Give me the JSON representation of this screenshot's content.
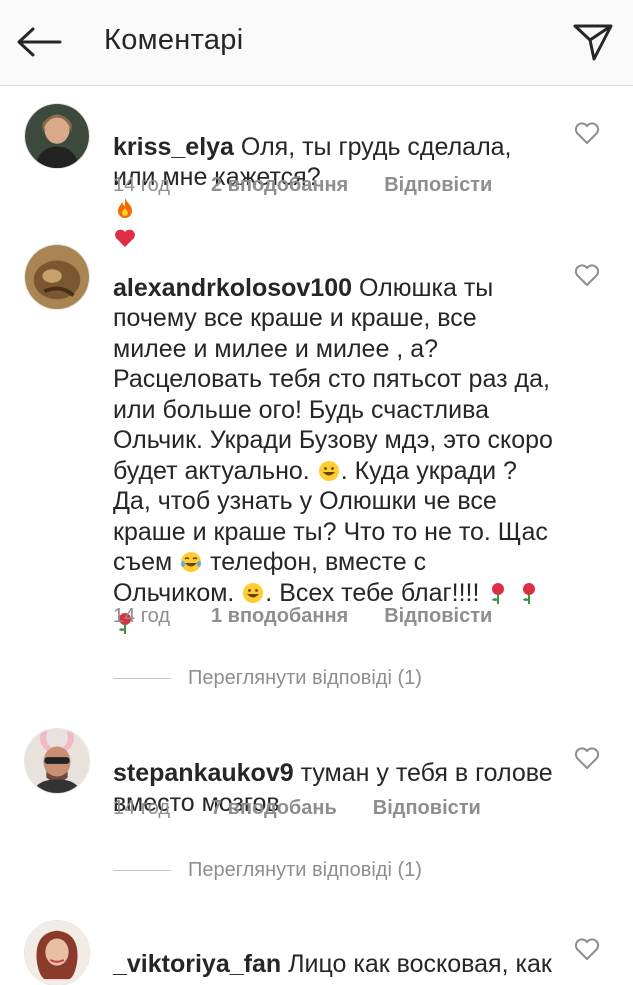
{
  "header": {
    "title": "Коментарі",
    "back_icon": "arrow-left-icon",
    "send_icon": "paper-plane-icon"
  },
  "colors": {
    "text": "#262626",
    "meta": "#8e8e8e",
    "heart_fill": "#e0245e",
    "fire": "#f56a00"
  },
  "comments": [
    {
      "username": "kriss_elya",
      "text": " Оля, ты грудь сделала, или мне кажется?",
      "emojis": [
        "fire-emoji",
        "red-heart-emoji"
      ],
      "time": "14 год",
      "likes": "2 вподобання",
      "reply": "Відповісти"
    },
    {
      "username": "alexandrkolosov100",
      "text_a": " Олюшка ты почему все краше и краше, все милее и милее и милее , а? Расцеловать тебя сто пятьсот раз да, или больше ого! Будь счастлива Ольчик. Укради Бузову мдэ, это скоро будет актуально. ",
      "text_b": ". Куда укради ? Да, чтоб узнать у Олюшки че все краше и краше ты? Что то не то. Щас съем ",
      "text_c": " телефон, вместе с Ольчиком. ",
      "text_d": ". Всех тебе благ!!!! ",
      "time": "14 год",
      "likes": "1 вподобання",
      "reply": "Відповісти",
      "view_replies": "Переглянути відповіді (1)"
    },
    {
      "username": "stepankaukov9",
      "text": " туман у тебя в голове вместо мозгов",
      "time": "14 год",
      "likes": "7 вподобань",
      "reply": "Відповісти",
      "view_replies": "Переглянути відповіді (1)"
    },
    {
      "username": "_viktoriya_fan",
      "text": " Лицо как восковая, как трансвестит"
    }
  ]
}
